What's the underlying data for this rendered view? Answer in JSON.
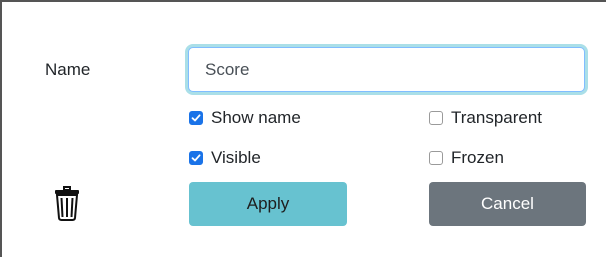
{
  "form": {
    "name_label": "Name",
    "name_value": "Score",
    "checkboxes": {
      "show_name": {
        "label": "Show name",
        "checked": true
      },
      "visible": {
        "label": "Visible",
        "checked": true
      },
      "transparent": {
        "label": "Transparent",
        "checked": false
      },
      "frozen": {
        "label": "Frozen",
        "checked": false
      }
    },
    "apply_label": "Apply",
    "cancel_label": "Cancel",
    "delete_icon": "trash-icon"
  },
  "colors": {
    "checkbox_checked": "#1a73e8",
    "apply_bg": "#67c2d0",
    "cancel_bg": "#6c757d",
    "input_focus_glow": "#65c4d6"
  }
}
